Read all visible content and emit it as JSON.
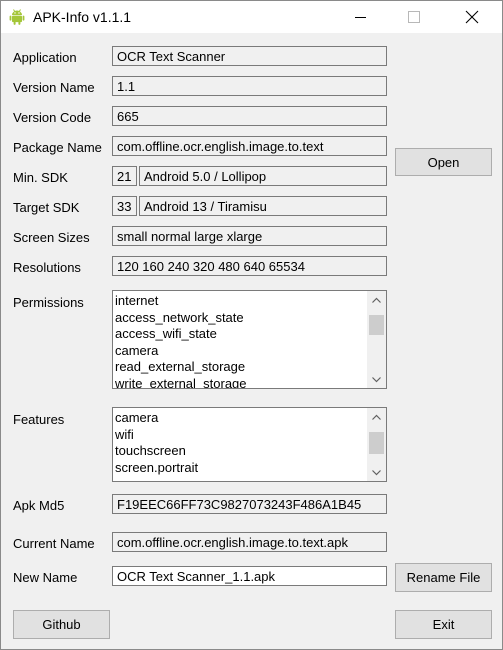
{
  "window": {
    "title": "APK-Info v1.1.1",
    "icon": "android-icon",
    "controls": [
      "minimize-icon",
      "maximize-icon",
      "close-icon"
    ]
  },
  "fields": {
    "application": {
      "label": "Application",
      "value": "OCR Text Scanner"
    },
    "version_name": {
      "label": "Version Name",
      "value": "1.1"
    },
    "version_code": {
      "label": "Version Code",
      "value": "665"
    },
    "package_name": {
      "label": "Package Name",
      "value": "com.offline.ocr.english.image.to.text"
    },
    "min_sdk": {
      "label": "Min. SDK",
      "value": "21",
      "description": "Android 5.0 / Lollipop"
    },
    "target_sdk": {
      "label": "Target SDK",
      "value": "33",
      "description": "Android 13 / Tiramisu"
    },
    "screen_sizes": {
      "label": "Screen Sizes",
      "value": "small normal large xlarge"
    },
    "resolutions": {
      "label": "Resolutions",
      "value": "120 160 240 320 480 640 65534"
    },
    "permissions": {
      "label": "Permissions",
      "items": [
        "internet",
        "access_network_state",
        "access_wifi_state",
        "camera",
        "read_external_storage",
        "write_external_storage"
      ]
    },
    "features": {
      "label": "Features",
      "items": [
        "camera",
        "wifi",
        "touchscreen",
        "screen.portrait"
      ]
    },
    "apk_md5": {
      "label": "Apk Md5",
      "value": "F19EEC66FF73C9827073243F486A1B45"
    },
    "current_name": {
      "label": "Current Name",
      "value": "com.offline.ocr.english.image.to.text.apk"
    },
    "new_name": {
      "label": "New Name",
      "value": "OCR Text Scanner_1.1.apk"
    }
  },
  "buttons": {
    "open": "Open",
    "rename": "Rename File",
    "github": "Github",
    "exit": "Exit"
  },
  "colors": {
    "window_bg": "#f0f0f0",
    "titlebar_bg": "#ffffff",
    "button_bg": "#e1e1e1",
    "android_green": "#a4c639"
  }
}
